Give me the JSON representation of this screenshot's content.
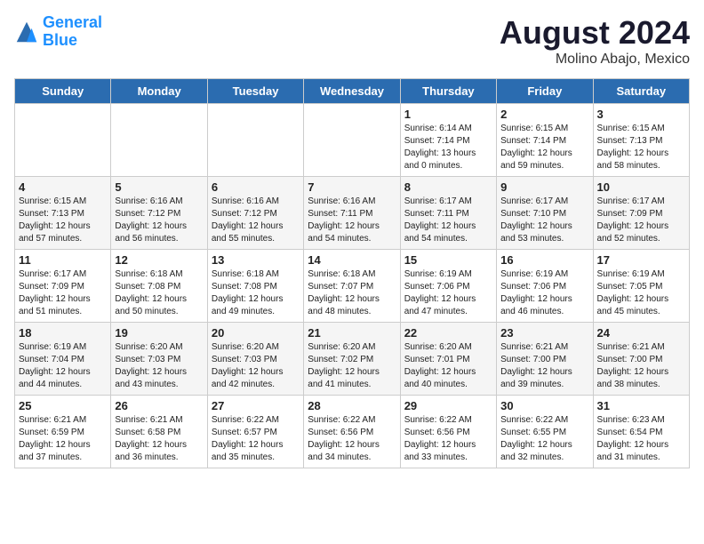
{
  "logo": {
    "line1": "General",
    "line2": "Blue"
  },
  "title": {
    "month_year": "August 2024",
    "location": "Molino Abajo, Mexico"
  },
  "weekdays": [
    "Sunday",
    "Monday",
    "Tuesday",
    "Wednesday",
    "Thursday",
    "Friday",
    "Saturday"
  ],
  "weeks": [
    [
      {
        "day": "",
        "info": ""
      },
      {
        "day": "",
        "info": ""
      },
      {
        "day": "",
        "info": ""
      },
      {
        "day": "",
        "info": ""
      },
      {
        "day": "1",
        "info": "Sunrise: 6:14 AM\nSunset: 7:14 PM\nDaylight: 13 hours\nand 0 minutes."
      },
      {
        "day": "2",
        "info": "Sunrise: 6:15 AM\nSunset: 7:14 PM\nDaylight: 12 hours\nand 59 minutes."
      },
      {
        "day": "3",
        "info": "Sunrise: 6:15 AM\nSunset: 7:13 PM\nDaylight: 12 hours\nand 58 minutes."
      }
    ],
    [
      {
        "day": "4",
        "info": "Sunrise: 6:15 AM\nSunset: 7:13 PM\nDaylight: 12 hours\nand 57 minutes."
      },
      {
        "day": "5",
        "info": "Sunrise: 6:16 AM\nSunset: 7:12 PM\nDaylight: 12 hours\nand 56 minutes."
      },
      {
        "day": "6",
        "info": "Sunrise: 6:16 AM\nSunset: 7:12 PM\nDaylight: 12 hours\nand 55 minutes."
      },
      {
        "day": "7",
        "info": "Sunrise: 6:16 AM\nSunset: 7:11 PM\nDaylight: 12 hours\nand 54 minutes."
      },
      {
        "day": "8",
        "info": "Sunrise: 6:17 AM\nSunset: 7:11 PM\nDaylight: 12 hours\nand 54 minutes."
      },
      {
        "day": "9",
        "info": "Sunrise: 6:17 AM\nSunset: 7:10 PM\nDaylight: 12 hours\nand 53 minutes."
      },
      {
        "day": "10",
        "info": "Sunrise: 6:17 AM\nSunset: 7:09 PM\nDaylight: 12 hours\nand 52 minutes."
      }
    ],
    [
      {
        "day": "11",
        "info": "Sunrise: 6:17 AM\nSunset: 7:09 PM\nDaylight: 12 hours\nand 51 minutes."
      },
      {
        "day": "12",
        "info": "Sunrise: 6:18 AM\nSunset: 7:08 PM\nDaylight: 12 hours\nand 50 minutes."
      },
      {
        "day": "13",
        "info": "Sunrise: 6:18 AM\nSunset: 7:08 PM\nDaylight: 12 hours\nand 49 minutes."
      },
      {
        "day": "14",
        "info": "Sunrise: 6:18 AM\nSunset: 7:07 PM\nDaylight: 12 hours\nand 48 minutes."
      },
      {
        "day": "15",
        "info": "Sunrise: 6:19 AM\nSunset: 7:06 PM\nDaylight: 12 hours\nand 47 minutes."
      },
      {
        "day": "16",
        "info": "Sunrise: 6:19 AM\nSunset: 7:06 PM\nDaylight: 12 hours\nand 46 minutes."
      },
      {
        "day": "17",
        "info": "Sunrise: 6:19 AM\nSunset: 7:05 PM\nDaylight: 12 hours\nand 45 minutes."
      }
    ],
    [
      {
        "day": "18",
        "info": "Sunrise: 6:19 AM\nSunset: 7:04 PM\nDaylight: 12 hours\nand 44 minutes."
      },
      {
        "day": "19",
        "info": "Sunrise: 6:20 AM\nSunset: 7:03 PM\nDaylight: 12 hours\nand 43 minutes."
      },
      {
        "day": "20",
        "info": "Sunrise: 6:20 AM\nSunset: 7:03 PM\nDaylight: 12 hours\nand 42 minutes."
      },
      {
        "day": "21",
        "info": "Sunrise: 6:20 AM\nSunset: 7:02 PM\nDaylight: 12 hours\nand 41 minutes."
      },
      {
        "day": "22",
        "info": "Sunrise: 6:20 AM\nSunset: 7:01 PM\nDaylight: 12 hours\nand 40 minutes."
      },
      {
        "day": "23",
        "info": "Sunrise: 6:21 AM\nSunset: 7:00 PM\nDaylight: 12 hours\nand 39 minutes."
      },
      {
        "day": "24",
        "info": "Sunrise: 6:21 AM\nSunset: 7:00 PM\nDaylight: 12 hours\nand 38 minutes."
      }
    ],
    [
      {
        "day": "25",
        "info": "Sunrise: 6:21 AM\nSunset: 6:59 PM\nDaylight: 12 hours\nand 37 minutes."
      },
      {
        "day": "26",
        "info": "Sunrise: 6:21 AM\nSunset: 6:58 PM\nDaylight: 12 hours\nand 36 minutes."
      },
      {
        "day": "27",
        "info": "Sunrise: 6:22 AM\nSunset: 6:57 PM\nDaylight: 12 hours\nand 35 minutes."
      },
      {
        "day": "28",
        "info": "Sunrise: 6:22 AM\nSunset: 6:56 PM\nDaylight: 12 hours\nand 34 minutes."
      },
      {
        "day": "29",
        "info": "Sunrise: 6:22 AM\nSunset: 6:56 PM\nDaylight: 12 hours\nand 33 minutes."
      },
      {
        "day": "30",
        "info": "Sunrise: 6:22 AM\nSunset: 6:55 PM\nDaylight: 12 hours\nand 32 minutes."
      },
      {
        "day": "31",
        "info": "Sunrise: 6:23 AM\nSunset: 6:54 PM\nDaylight: 12 hours\nand 31 minutes."
      }
    ]
  ]
}
